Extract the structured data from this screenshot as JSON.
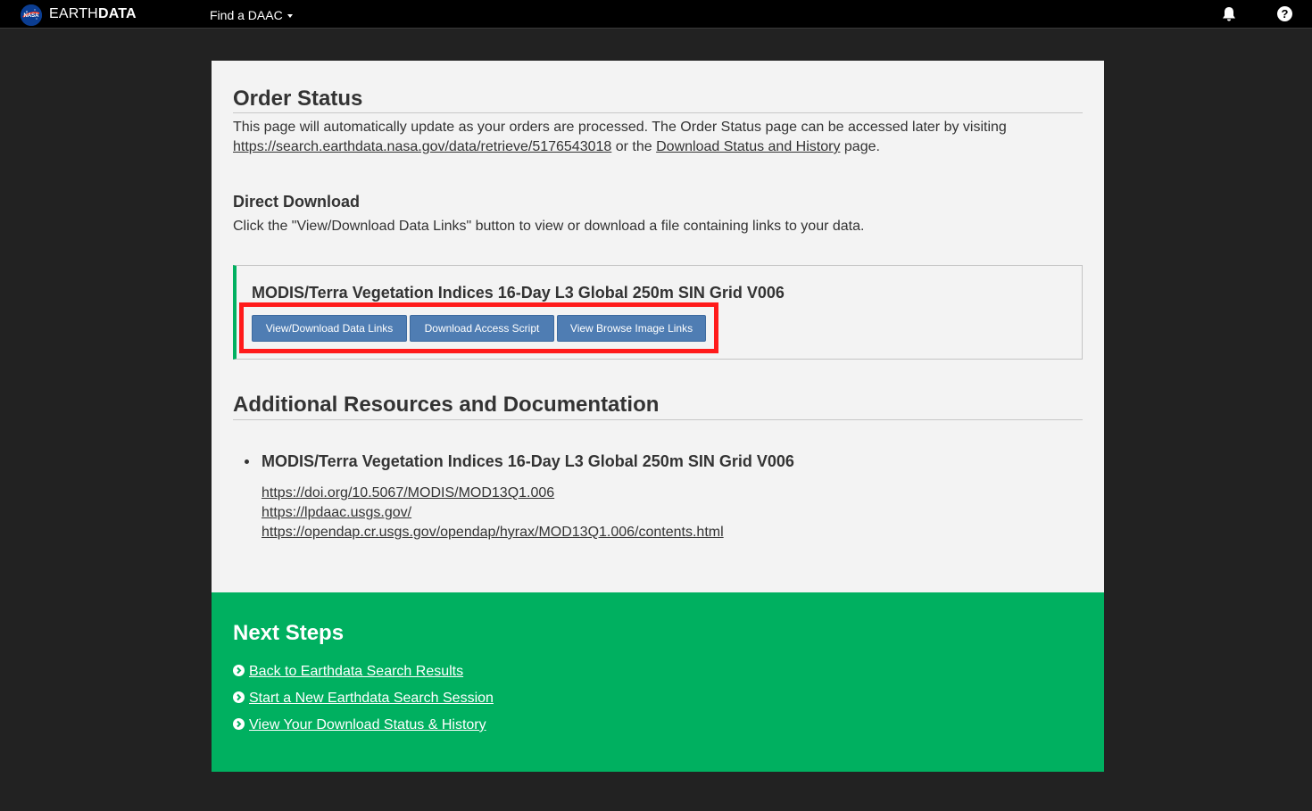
{
  "header": {
    "brand_light": "EARTH",
    "brand_bold": "DATA",
    "daac_menu_label": "Find a DAAC",
    "logo_icon": "nasa-logo-icon",
    "bell_icon": "bell-icon",
    "help_icon": "question-circle-icon",
    "help_glyph": "?"
  },
  "order_status": {
    "title": "Order Status",
    "intro_text": "This page will automatically update as your orders are processed. The Order Status page can be accessed later by visiting",
    "retrieve_url": "https://search.earthdata.nasa.gov/data/retrieve/5176543018",
    "or_the_text": "or the",
    "history_link": "Download Status and History",
    "page_text": "page."
  },
  "direct_download": {
    "title": "Direct Download",
    "description": "Click the \"View/Download Data Links\" button to view or download a file containing links to your data.",
    "collection_title": "MODIS/Terra Vegetation Indices 16-Day L3 Global 250m SIN Grid V006",
    "buttons": {
      "data_links": "View/Download Data Links",
      "access_script": "Download Access Script",
      "browse_links": "View Browse Image Links"
    }
  },
  "resources": {
    "title": "Additional Resources and Documentation",
    "collection_title": "MODIS/Terra Vegetation Indices 16-Day L3 Global 250m SIN Grid V006",
    "links": [
      "https://doi.org/10.5067/MODIS/MOD13Q1.006",
      "https://lpdaac.usgs.gov/",
      "https://opendap.cr.usgs.gov/opendap/hyrax/MOD13Q1.006/contents.html"
    ]
  },
  "next_steps": {
    "title": "Next Steps",
    "items": [
      "Back to Earthdata Search Results",
      "Start a New Earthdata Search Session",
      "View Your Download Status & History"
    ],
    "item_icon": "chevron-circle-right-icon"
  },
  "colors": {
    "page_background": "#222222",
    "panel_background": "#f3f3f3",
    "accent_green": "#00b060",
    "button_blue": "#4f7db3",
    "highlight_red": "#ff1a1a"
  }
}
